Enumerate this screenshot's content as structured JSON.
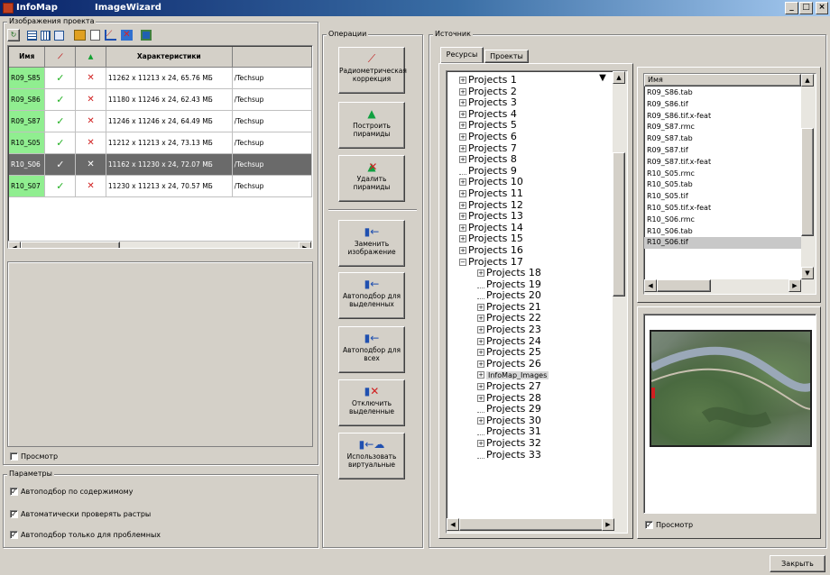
{
  "window": {
    "app_name": "InfoMap",
    "title": "ImageWizard",
    "min": "_",
    "max": "□",
    "close": "×"
  },
  "project_images": {
    "label": "Изображения проекта",
    "columns": [
      "Имя",
      "",
      "",
      "Характеристики"
    ],
    "rows": [
      {
        "name": "R09_S85",
        "c1": "✓",
        "c2": "✕",
        "info": "11262 x 11213 x 24, 65.76 МБ",
        "path": "/Techsup",
        "selected": false
      },
      {
        "name": "R09_S86",
        "c1": "✓",
        "c2": "✕",
        "info": "11180 x 11246 x 24, 62.43 МБ",
        "path": "/Techsup",
        "selected": false
      },
      {
        "name": "R09_S87",
        "c1": "✓",
        "c2": "✕",
        "info": "11246 x 11246 x 24, 64.49 МБ",
        "path": "/Techsup",
        "selected": false
      },
      {
        "name": "R10_S05",
        "c1": "✓",
        "c2": "✕",
        "info": "11212 x 11213 x 24, 73.13 МБ",
        "path": "/Techsup",
        "selected": false
      },
      {
        "name": "R10_S06",
        "c1": "✓",
        "c2": "✕",
        "info": "11162 x 11230 x 24, 72.07 МБ",
        "path": "/Techsup",
        "selected": true
      },
      {
        "name": "R10_S07",
        "c1": "✓",
        "c2": "✕",
        "info": "11230 x 11213 x 24, 70.57 МБ",
        "path": "/Techsup",
        "selected": false
      }
    ],
    "preview_label": "Просмотр"
  },
  "params": {
    "label": "Параметры",
    "options": [
      "Автоподбор по содержимому",
      "Автоматически проверять растры",
      "Автоподбор только для проблемных"
    ],
    "checked": [
      "✓",
      "✓",
      "✓"
    ]
  },
  "operations": {
    "label": "Операции",
    "buttons": [
      {
        "label": "Радиометрическая коррекция",
        "icon": "radiometric-icon"
      },
      {
        "label": "Построить пирамиды",
        "icon": "pyramid-build-icon"
      },
      {
        "label": "Удалить пирамиды",
        "icon": "pyramid-delete-icon"
      },
      {
        "label": "Заменить изображение",
        "icon": "replace-image-icon"
      },
      {
        "label": "Автоподбор для выделенных",
        "icon": "autoselect-selected-icon"
      },
      {
        "label": "Автоподбор для всех",
        "icon": "autoselect-all-icon"
      },
      {
        "label": "Отключить выделенные",
        "icon": "disable-selected-icon"
      },
      {
        "label": "Использовать виртуальные",
        "icon": "use-virtual-icon"
      }
    ]
  },
  "source": {
    "label": "Источник",
    "tabs": [
      "Ресурсы",
      "Проекты"
    ],
    "tree": [
      {
        "t": "Projects 1",
        "l": 0,
        "e": "+"
      },
      {
        "t": "Projects 2",
        "l": 0,
        "e": "+"
      },
      {
        "t": "Projects 3",
        "l": 0,
        "e": "+"
      },
      {
        "t": "Projects 4",
        "l": 0,
        "e": "+"
      },
      {
        "t": "Projects 5",
        "l": 0,
        "e": "+"
      },
      {
        "t": "Projects 6",
        "l": 0,
        "e": "+"
      },
      {
        "t": "Projects 7",
        "l": 0,
        "e": "+"
      },
      {
        "t": "Projects 8",
        "l": 0,
        "e": "+"
      },
      {
        "t": "Projects 9",
        "l": 0,
        "e": ""
      },
      {
        "t": "Projects 10",
        "l": 0,
        "e": "+"
      },
      {
        "t": "Projects 11",
        "l": 0,
        "e": "+"
      },
      {
        "t": "Projects 12",
        "l": 0,
        "e": "+"
      },
      {
        "t": "Projects 13",
        "l": 0,
        "e": "+"
      },
      {
        "t": "Projects 14",
        "l": 0,
        "e": "+"
      },
      {
        "t": "Projects 15",
        "l": 0,
        "e": "+"
      },
      {
        "t": "Projects 16",
        "l": 0,
        "e": "+"
      },
      {
        "t": "Projects 17",
        "l": 0,
        "e": "−"
      },
      {
        "t": "Projects 18",
        "l": 1,
        "e": "+"
      },
      {
        "t": "Projects 19",
        "l": 1,
        "e": ""
      },
      {
        "t": "Projects 20",
        "l": 1,
        "e": ""
      },
      {
        "t": "Projects 21",
        "l": 1,
        "e": "+"
      },
      {
        "t": "Projects 22",
        "l": 1,
        "e": "+"
      },
      {
        "t": "Projects 23",
        "l": 1,
        "e": "+"
      },
      {
        "t": "Projects 24",
        "l": 1,
        "e": "+"
      },
      {
        "t": "Projects 25",
        "l": 1,
        "e": "+"
      },
      {
        "t": "Projects 26",
        "l": 1,
        "e": "+"
      },
      {
        "t": "InfoMap_Images",
        "l": 1,
        "e": "+",
        "sel": true
      },
      {
        "t": "Projects 27",
        "l": 1,
        "e": "+"
      },
      {
        "t": "Projects 28",
        "l": 1,
        "e": "+"
      },
      {
        "t": "Projects 29",
        "l": 1,
        "e": ""
      },
      {
        "t": "Projects 30",
        "l": 1,
        "e": "+"
      },
      {
        "t": "Projects 31",
        "l": 1,
        "e": ""
      },
      {
        "t": "Projects 32",
        "l": 1,
        "e": "+"
      },
      {
        "t": "Projects 33",
        "l": 1,
        "e": ""
      }
    ],
    "files_header": "Имя",
    "files": [
      "R09_S86.tab",
      "R09_S86.tif",
      "R09_S86.tif.x-feat",
      "R09_S87.rmc",
      "R09_S87.tab",
      "R09_S87.tif",
      "R09_S87.tif.x-feat",
      "R10_S05.rmc",
      "R10_S05.tab",
      "R10_S05.tif",
      "R10_S05.tif.x-feat",
      "R10_S06.rmc",
      "R10_S06.tab",
      "R10_S06.tif"
    ],
    "preview_label": "Просмотр"
  },
  "close_button": "Закрыть"
}
